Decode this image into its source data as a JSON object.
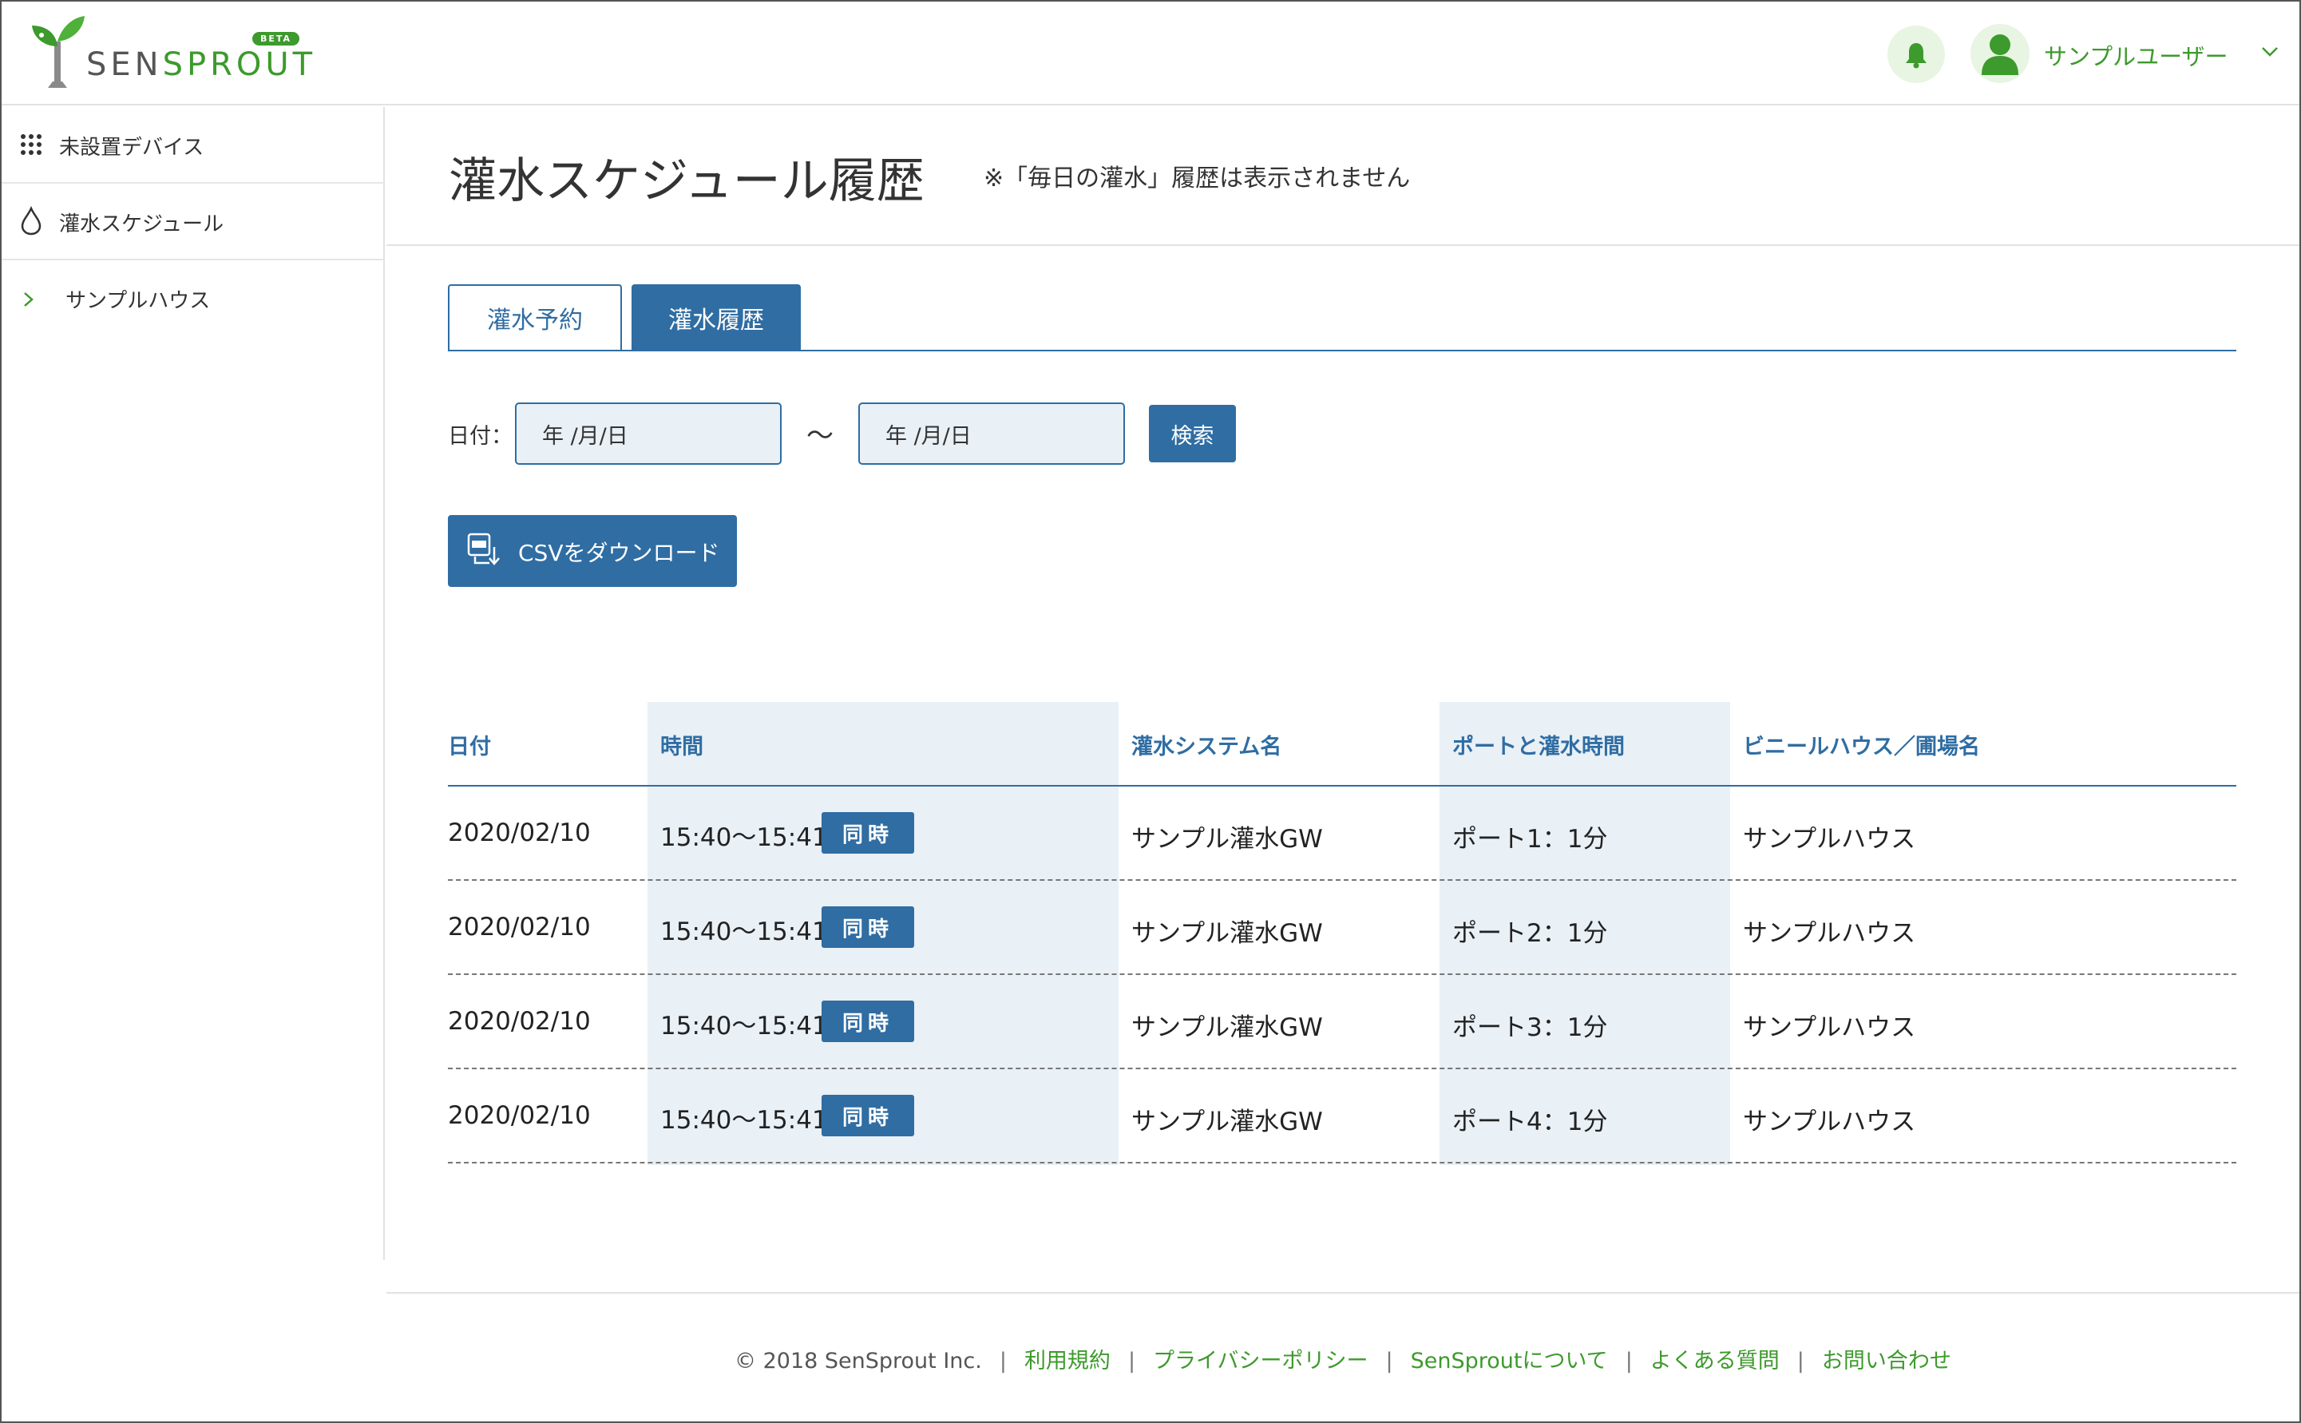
{
  "colors": {
    "brand_green": "#3d9a2c",
    "accent_blue": "#2f6da3",
    "shade_blue": "#e9f0f6",
    "light_green": "#e7f5e2"
  },
  "header": {
    "logo_text_1": "SEN",
    "logo_text_2": "SPROUT",
    "beta_label": "BETA",
    "bell_icon": "bell-icon",
    "user_name": "サンプルユーザー",
    "user_chevron_icon": "chevron-down-icon"
  },
  "sidebar": {
    "items": [
      {
        "label": "未設置デバイス",
        "icon": "grid-icon"
      },
      {
        "label": "灌水スケジュール",
        "icon": "water-drop-icon"
      },
      {
        "label": "サンプルハウス",
        "icon": "chevron-right-icon"
      }
    ]
  },
  "page": {
    "title": "灌水スケジュール履歴",
    "note": "※「毎日の灌水」履歴は表示されません"
  },
  "tabs": [
    {
      "label": "灌水予約",
      "active": false
    },
    {
      "label": "灌水履歴",
      "active": true
    }
  ],
  "filter": {
    "label": "日付：",
    "from_value": "年 /月/日",
    "tilde": "〜",
    "to_value": "年 /月/日",
    "search_label": "検索"
  },
  "csv_button": {
    "label": "CSVをダウンロード",
    "icon": "csv-download-icon"
  },
  "table": {
    "headers": [
      "日付",
      "時間",
      "灌水システム名",
      "ポートと灌水時間",
      "ビニールハウス／圃場名"
    ],
    "rows": [
      {
        "date": "2020/02/10",
        "time": "15:40〜15:41",
        "badge": "同時",
        "system": "サンプル灌水GW",
        "port": "ポート1：1分",
        "house": "サンプルハウス"
      },
      {
        "date": "2020/02/10",
        "time": "15:40〜15:41",
        "badge": "同時",
        "system": "サンプル灌水GW",
        "port": "ポート2：1分",
        "house": "サンプルハウス"
      },
      {
        "date": "2020/02/10",
        "time": "15:40〜15:41",
        "badge": "同時",
        "system": "サンプル灌水GW",
        "port": "ポート3：1分",
        "house": "サンプルハウス"
      },
      {
        "date": "2020/02/10",
        "time": "15:40〜15:41",
        "badge": "同時",
        "system": "サンプル灌水GW",
        "port": "ポート4：1分",
        "house": "サンプルハウス"
      }
    ]
  },
  "footer": {
    "copyright": "© 2018 SenSprout Inc.",
    "separator": "|",
    "links": [
      "利用規約",
      "プライバシーポリシー",
      "SenSproutについて",
      "よくある質問",
      "お問い合わせ"
    ]
  }
}
